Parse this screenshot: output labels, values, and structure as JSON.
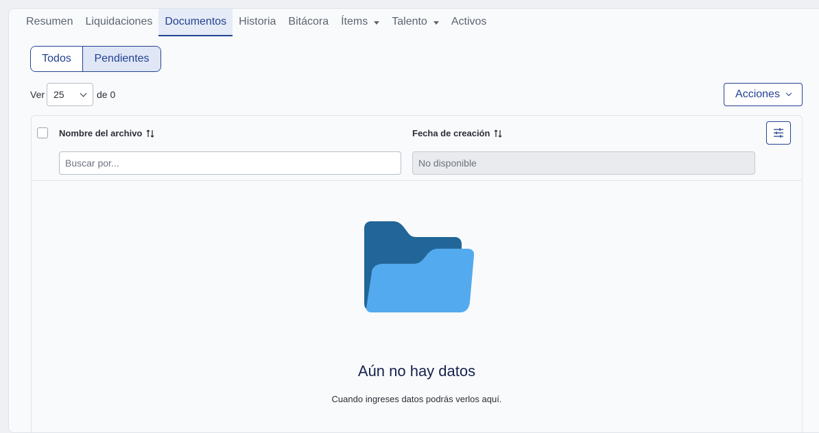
{
  "tabs": [
    {
      "label": "Resumen",
      "dropdown": false
    },
    {
      "label": "Liquidaciones",
      "dropdown": false
    },
    {
      "label": "Documentos",
      "dropdown": false,
      "active": true
    },
    {
      "label": "Historia",
      "dropdown": false
    },
    {
      "label": "Bitácora",
      "dropdown": false
    },
    {
      "label": "Ítems",
      "dropdown": true
    },
    {
      "label": "Talento",
      "dropdown": true
    },
    {
      "label": "Activos",
      "dropdown": false
    }
  ],
  "filter_toggle": {
    "all_label": "Todos",
    "pending_label": "Pendientes",
    "selected": "Pendientes"
  },
  "pagination": {
    "prefix": "Ver",
    "page_size": "25",
    "suffix": "de 0"
  },
  "actions_label": "Acciones",
  "table": {
    "columns": [
      {
        "label": "Nombre del archivo",
        "filter_placeholder": "Buscar por...",
        "filter_disabled": false
      },
      {
        "label": "Fecha de creación",
        "filter_placeholder": "No disponible",
        "filter_disabled": true
      }
    ],
    "rows": []
  },
  "empty_state": {
    "title": "Aún no hay datos",
    "subtitle": "Cuando ingreses datos podrás verlos aquí."
  },
  "colors": {
    "primary": "#22418f",
    "folder_back": "#226699",
    "folder_front": "#54aaee",
    "active_tab_bg": "#e5ebf7"
  }
}
